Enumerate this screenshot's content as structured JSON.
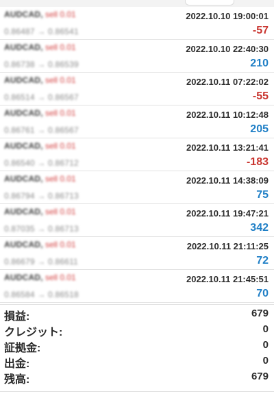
{
  "trades": [
    {
      "symbol": "AUDCAD,",
      "side": "sell 0.01",
      "prices": "0.86487 → 0.86541",
      "datetime": "2022.10.10 19:00:01",
      "profit": "-57",
      "sign": "neg"
    },
    {
      "symbol": "AUDCAD,",
      "side": "sell 0.01",
      "prices": "0.86738 → 0.86539",
      "datetime": "2022.10.10 22:40:30",
      "profit": "210",
      "sign": "pos"
    },
    {
      "symbol": "AUDCAD,",
      "side": "sell 0.01",
      "prices": "0.86514 → 0.86567",
      "datetime": "2022.10.11 07:22:02",
      "profit": "-55",
      "sign": "neg"
    },
    {
      "symbol": "AUDCAD,",
      "side": "sell 0.01",
      "prices": "0.86761 → 0.86567",
      "datetime": "2022.10.11 10:12:48",
      "profit": "205",
      "sign": "pos"
    },
    {
      "symbol": "AUDCAD,",
      "side": "sell 0.01",
      "prices": "0.86540 → 0.86712",
      "datetime": "2022.10.11 13:21:41",
      "profit": "-183",
      "sign": "neg"
    },
    {
      "symbol": "AUDCAD,",
      "side": "sell 0.01",
      "prices": "0.86794 → 0.86713",
      "datetime": "2022.10.11 14:38:09",
      "profit": "75",
      "sign": "pos"
    },
    {
      "symbol": "AUDCAD,",
      "side": "sell 0.01",
      "prices": "0.87035 → 0.86713",
      "datetime": "2022.10.11 19:47:21",
      "profit": "342",
      "sign": "pos"
    },
    {
      "symbol": "AUDCAD,",
      "side": "sell 0.01",
      "prices": "0.86679 → 0.86611",
      "datetime": "2022.10.11 21:11:25",
      "profit": "72",
      "sign": "pos"
    },
    {
      "symbol": "AUDCAD,",
      "side": "sell 0.01",
      "prices": "0.86584 → 0.86518",
      "datetime": "2022.10.11 21:45:51",
      "profit": "70",
      "sign": "pos"
    }
  ],
  "summary": {
    "profit_label": "損益:",
    "profit_value": "679",
    "credit_label": "クレジット:",
    "credit_value": "0",
    "margin_label": "証拠金:",
    "margin_value": "0",
    "withdrawal_label": "出金:",
    "withdrawal_value": "0",
    "balance_label": "残高:",
    "balance_value": "679"
  },
  "colors": {
    "loss": "#c9352f",
    "gain": "#1f7fc6",
    "side": "#d23b3b"
  }
}
